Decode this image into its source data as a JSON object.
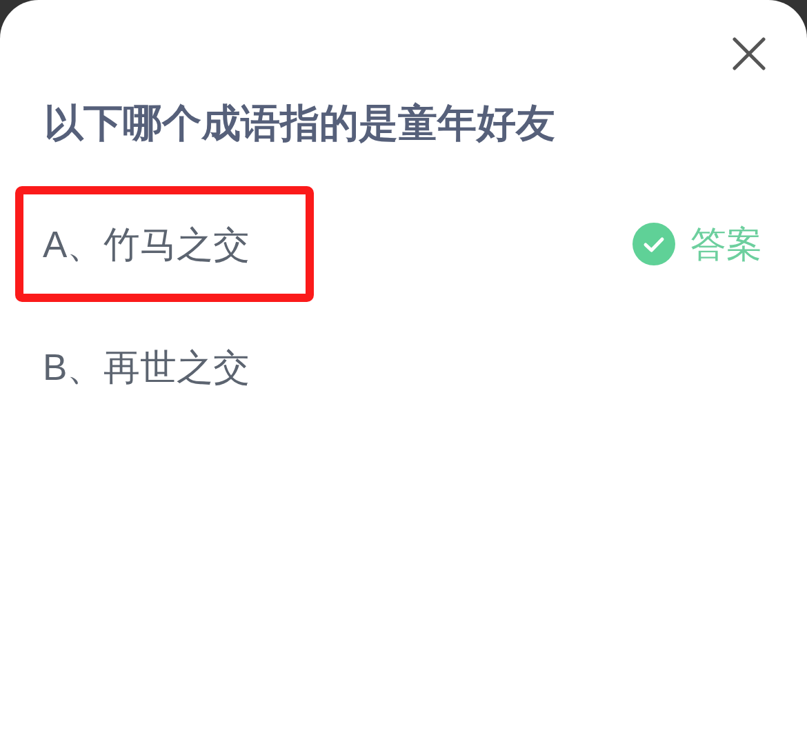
{
  "question": "以下哪个成语指的是童年好友",
  "answer_label": "答案",
  "options": [
    {
      "label": "A、竹马之交",
      "correct": true,
      "marked": true
    },
    {
      "label": "B、再世之交",
      "correct": false,
      "marked": false
    }
  ]
}
